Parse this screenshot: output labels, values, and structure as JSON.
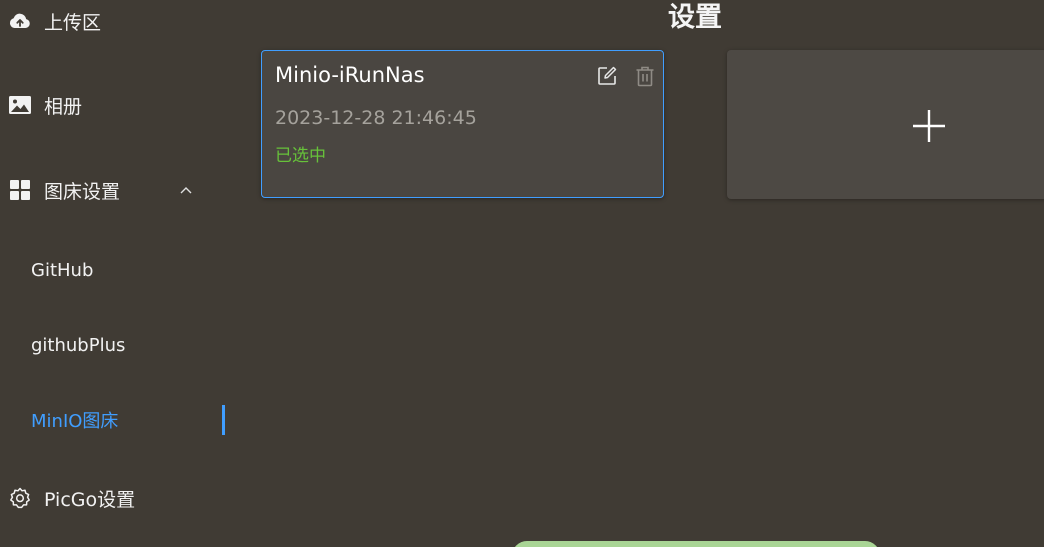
{
  "sidebar": {
    "items": [
      {
        "label": "上传区",
        "icon": "cloud-upload-icon"
      },
      {
        "label": "相册",
        "icon": "picture-icon"
      },
      {
        "label": "图床设置",
        "icon": "grid-icon",
        "expanded": true
      },
      {
        "label": "PicGo设置",
        "icon": "gear-icon"
      }
    ],
    "sub_items": [
      {
        "label": "GitHub",
        "active": false
      },
      {
        "label": "githubPlus",
        "active": false
      },
      {
        "label": "MinIO图床",
        "active": true
      }
    ]
  },
  "main": {
    "title": "设置",
    "config_card": {
      "name": "Minio-iRunNas",
      "time": "2023-12-28 21:46:45",
      "status": "已选中"
    }
  },
  "colors": {
    "background": "#403b34",
    "accent": "#409eff",
    "selected_status": "#67c23a",
    "card": "#4a4641"
  }
}
